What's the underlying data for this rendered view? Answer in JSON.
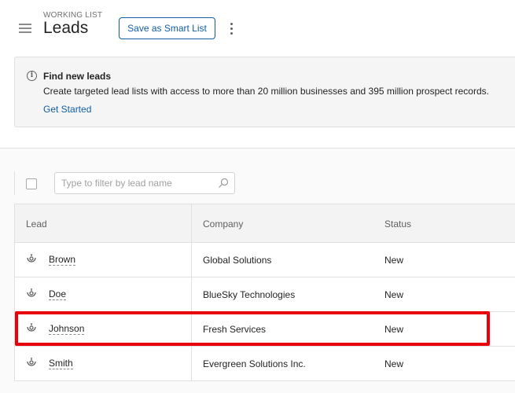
{
  "header": {
    "eyebrow": "WORKING LIST",
    "title": "Leads",
    "save_smart_list_label": "Save as Smart List"
  },
  "banner": {
    "title": "Find new leads",
    "description": "Create targeted lead lists with access to more than 20 million businesses and 395 million prospect records.",
    "link_label": "Get Started"
  },
  "filter": {
    "placeholder": "Type to filter by lead name"
  },
  "table": {
    "columns": [
      "Lead",
      "Company",
      "Status"
    ],
    "rows": [
      {
        "lead": "Brown",
        "company": "Global Solutions",
        "status": "New"
      },
      {
        "lead": "Doe",
        "company": "BlueSky Technologies",
        "status": "New"
      },
      {
        "lead": "Johnson",
        "company": "Fresh Services",
        "status": "New"
      },
      {
        "lead": "Smith",
        "company": "Evergreen Solutions Inc.",
        "status": "New"
      }
    ]
  },
  "colors": {
    "accent": "#115ea3",
    "highlight": "#e8000b"
  }
}
